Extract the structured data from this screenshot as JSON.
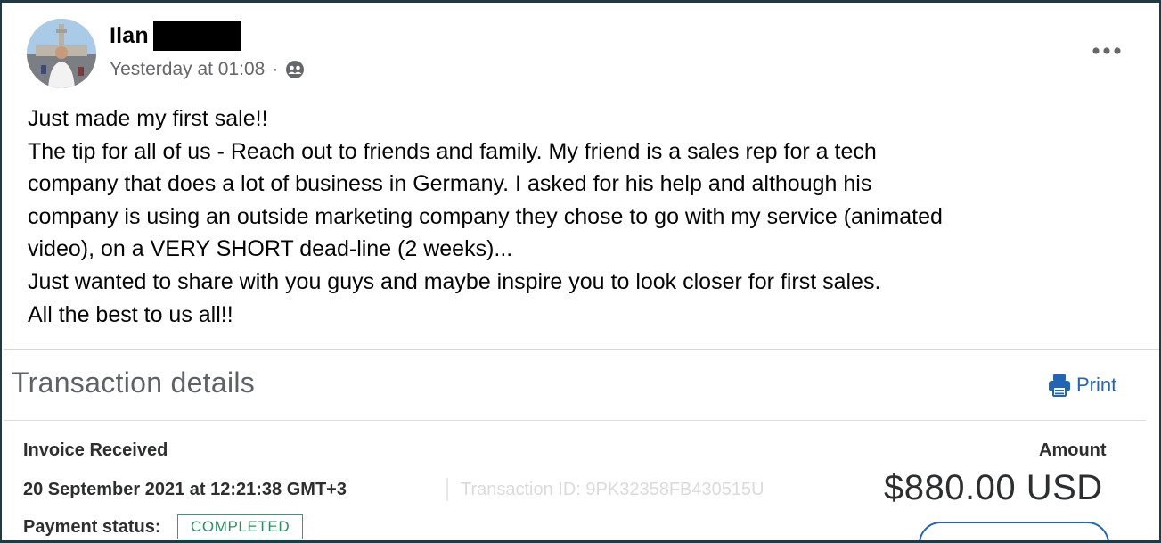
{
  "post": {
    "author_name": "Ilan",
    "timestamp": "Yesterday at 01:08",
    "separator": "·",
    "audience_icon": "friends-icon",
    "more_icon": "more-options-icon",
    "body_lines": [
      "Just made my first sale!!",
      "The tip for all of us - Reach out to friends and family. My friend is a sales rep for a tech",
      "company that does a lot of business in Germany. I asked for his help and although his",
      "company is using an outside marketing company they chose to go with my service (animated",
      "video), on a VERY SHORT dead-line (2 weeks)...",
      "Just wanted to share with you guys and maybe inspire you to look closer for first sales.",
      "All the best to us all!!"
    ]
  },
  "transaction": {
    "title": "Transaction details",
    "print_label": "Print",
    "print_icon": "printer-icon",
    "type_label": "Invoice Received",
    "date": "20 September 2021 at 12:21:38 GMT+3",
    "transaction_id": "Transaction ID: 9PK32358FB430515U",
    "payment_status_label": "Payment status:",
    "payment_status": "COMPLETED",
    "amount_label": "Amount",
    "amount": "$880.00 USD"
  },
  "colors": {
    "link_blue": "#2264b6",
    "status_green": "#2e9e73",
    "text_dark": "#050505",
    "text_muted": "#65676b"
  }
}
